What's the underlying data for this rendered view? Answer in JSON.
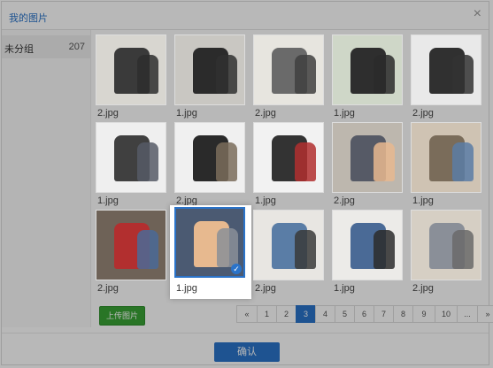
{
  "dialog": {
    "title": "我的图片",
    "close_glyph": "×"
  },
  "sidebar": {
    "groups": [
      {
        "name": "未分组",
        "count": "207"
      }
    ]
  },
  "images": [
    {
      "filename": "2.jpg",
      "selected": false
    },
    {
      "filename": "1.jpg",
      "selected": false
    },
    {
      "filename": "2.jpg",
      "selected": false
    },
    {
      "filename": "1.jpg",
      "selected": false
    },
    {
      "filename": "2.jpg",
      "selected": false
    },
    {
      "filename": "1.jpg",
      "selected": false
    },
    {
      "filename": "2.jpg",
      "selected": false
    },
    {
      "filename": "1.jpg",
      "selected": false
    },
    {
      "filename": "2.jpg",
      "selected": false
    },
    {
      "filename": "1.jpg",
      "selected": false
    },
    {
      "filename": "2.jpg",
      "selected": false
    },
    {
      "filename": "1.jpg",
      "selected": true
    },
    {
      "filename": "2.jpg",
      "selected": false
    },
    {
      "filename": "1.jpg",
      "selected": false
    },
    {
      "filename": "2.jpg",
      "selected": false
    }
  ],
  "upload_button": "上传图片",
  "pagination": {
    "prev": "«",
    "pages": [
      "1",
      "2",
      "3",
      "4",
      "5",
      "6",
      "7",
      "8",
      "9",
      "10"
    ],
    "ellipsis": "...",
    "next": "»",
    "current": "3"
  },
  "confirm_button": "确认",
  "check_glyph": "✓",
  "colors": {
    "accent": "#2a73c9",
    "upload_green": "#3aa335",
    "thumb_backgrounds": [
      "#d8d6d0",
      "#c9c7c2",
      "#e7e5df",
      "#cfd7c8",
      "#e9e9e9",
      "#efefef",
      "#f0f0f0",
      "#f2f2f2",
      "#bdb7ae",
      "#cfc3b3",
      "#6e6257",
      "#4b5a72",
      "#e8e6e2",
      "#ecebe8",
      "#d6cfc4"
    ],
    "garment_colors": [
      "#3a3a3a",
      "#2b2b2b",
      "#6a6a6a",
      "#2e2e2e",
      "#303030",
      "#404040",
      "#2a2a2a",
      "#333333",
      "#565a66",
      "#7a6c5a",
      "#b22f2f",
      "#e7b98f",
      "#5a7da6",
      "#4a6a96",
      "#8a8f98"
    ]
  }
}
